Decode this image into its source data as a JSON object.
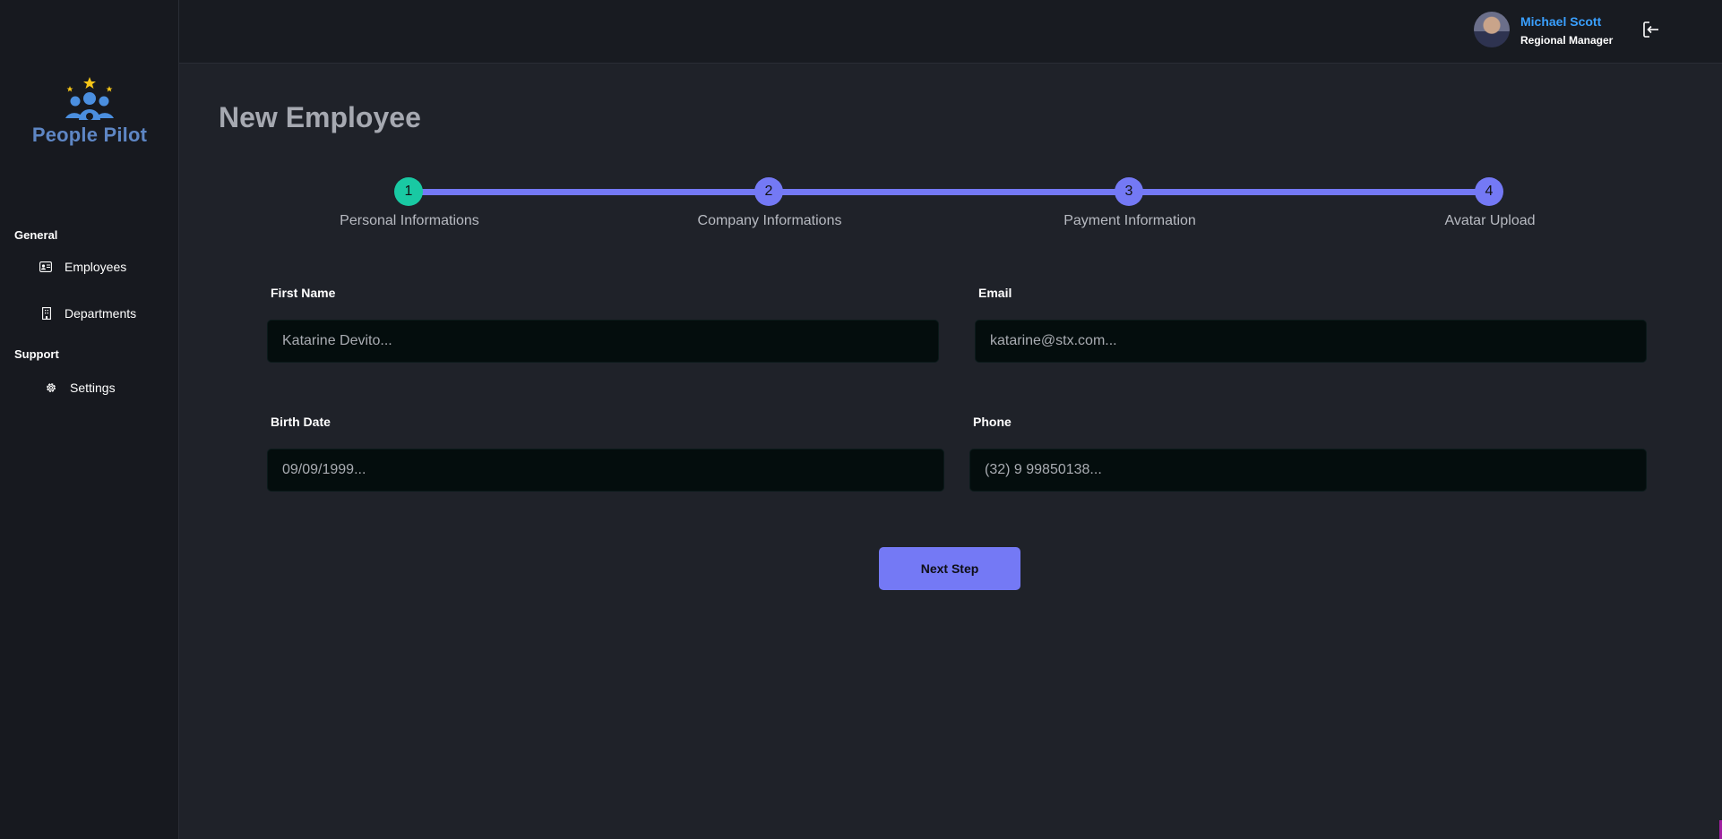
{
  "app": {
    "name": "People Pilot"
  },
  "sidebar": {
    "sections": [
      {
        "title": "General"
      },
      {
        "title": "Support"
      }
    ],
    "items": [
      {
        "label": "Employees",
        "icon": "id-card-icon"
      },
      {
        "label": "Departments",
        "icon": "building-icon"
      },
      {
        "label": "Settings",
        "icon": "gear-icon"
      }
    ]
  },
  "user": {
    "name": "Michael Scott",
    "role": "Regional Manager"
  },
  "page": {
    "title": "New Employee"
  },
  "stepper": {
    "current_step": 1,
    "steps": [
      {
        "number": "1",
        "label": "Personal Informations"
      },
      {
        "number": "2",
        "label": "Company Informations"
      },
      {
        "number": "3",
        "label": "Payment Information"
      },
      {
        "number": "4",
        "label": "Avatar Upload"
      }
    ]
  },
  "form": {
    "first_name": {
      "label": "First Name",
      "placeholder": "Katarine Devito..."
    },
    "email": {
      "label": "Email",
      "placeholder": "katarine@stx.com..."
    },
    "birth_date": {
      "label": "Birth Date",
      "placeholder": "09/09/1999..."
    },
    "phone": {
      "label": "Phone",
      "placeholder": "(32) 9 99850138..."
    },
    "next_label": "Next Step"
  },
  "colors": {
    "accent": "#7479f5",
    "active_step": "#19c9a3",
    "user_name": "#3aa0ff",
    "brand": "#5e86c4"
  }
}
